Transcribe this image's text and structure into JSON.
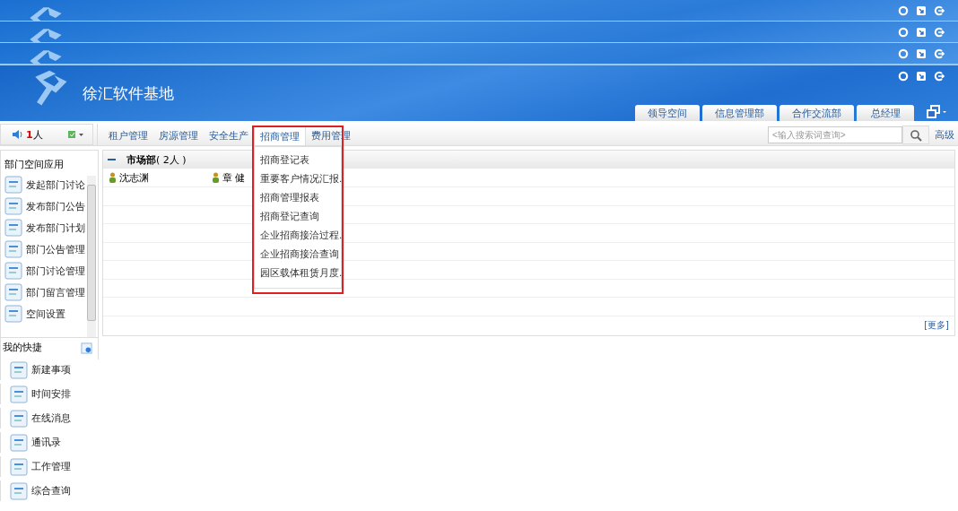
{
  "header_strips": [
    {
      "kind": "strip"
    },
    {
      "kind": "strip"
    },
    {
      "kind": "strip"
    }
  ],
  "header": {
    "title": "徐汇软件基地",
    "tabs": [
      {
        "label": "领导空间",
        "selected": false
      },
      {
        "label": "信息管理部",
        "selected": false
      },
      {
        "label": "合作交流部",
        "selected": false
      },
      {
        "label": "总经理",
        "selected": false
      }
    ]
  },
  "toolbar": {
    "online_count": "1",
    "online_unit": "人",
    "menu": [
      {
        "label": "租户管理",
        "selected": false
      },
      {
        "label": "房源管理",
        "selected": false
      },
      {
        "label": "安全生产",
        "selected": false
      },
      {
        "label": "招商管理",
        "selected": true
      },
      {
        "label": "费用管理",
        "selected": false
      }
    ],
    "search": {
      "placeholder": "<输入搜索词查询>"
    },
    "advanced": "高级"
  },
  "dropdown": {
    "highlighted": true,
    "items": [
      "招商登记表",
      "重要客户情况汇报.",
      "招商管理报表",
      "招商登记查询",
      "企业招商接洽过程.",
      "企业招商接洽查询",
      "园区载体租赁月度."
    ]
  },
  "sidebar": {
    "title": "部门空间应用",
    "items": [
      "发起部门讨论",
      "发布部门公告",
      "发布部门计划",
      "部门公告管理",
      "部门讨论管理",
      "部门留言管理",
      "空间设置"
    ],
    "quick_title": "我的快捷",
    "quick_items": [
      "新建事项",
      "时间安排",
      "在线消息",
      "通讯录",
      "工作管理",
      "综合查询"
    ]
  },
  "panel": {
    "group": "**市场部**( 2人 )",
    "expanded": true,
    "members": [
      "沈志渊",
      "章 健"
    ],
    "more": "[更多]"
  }
}
